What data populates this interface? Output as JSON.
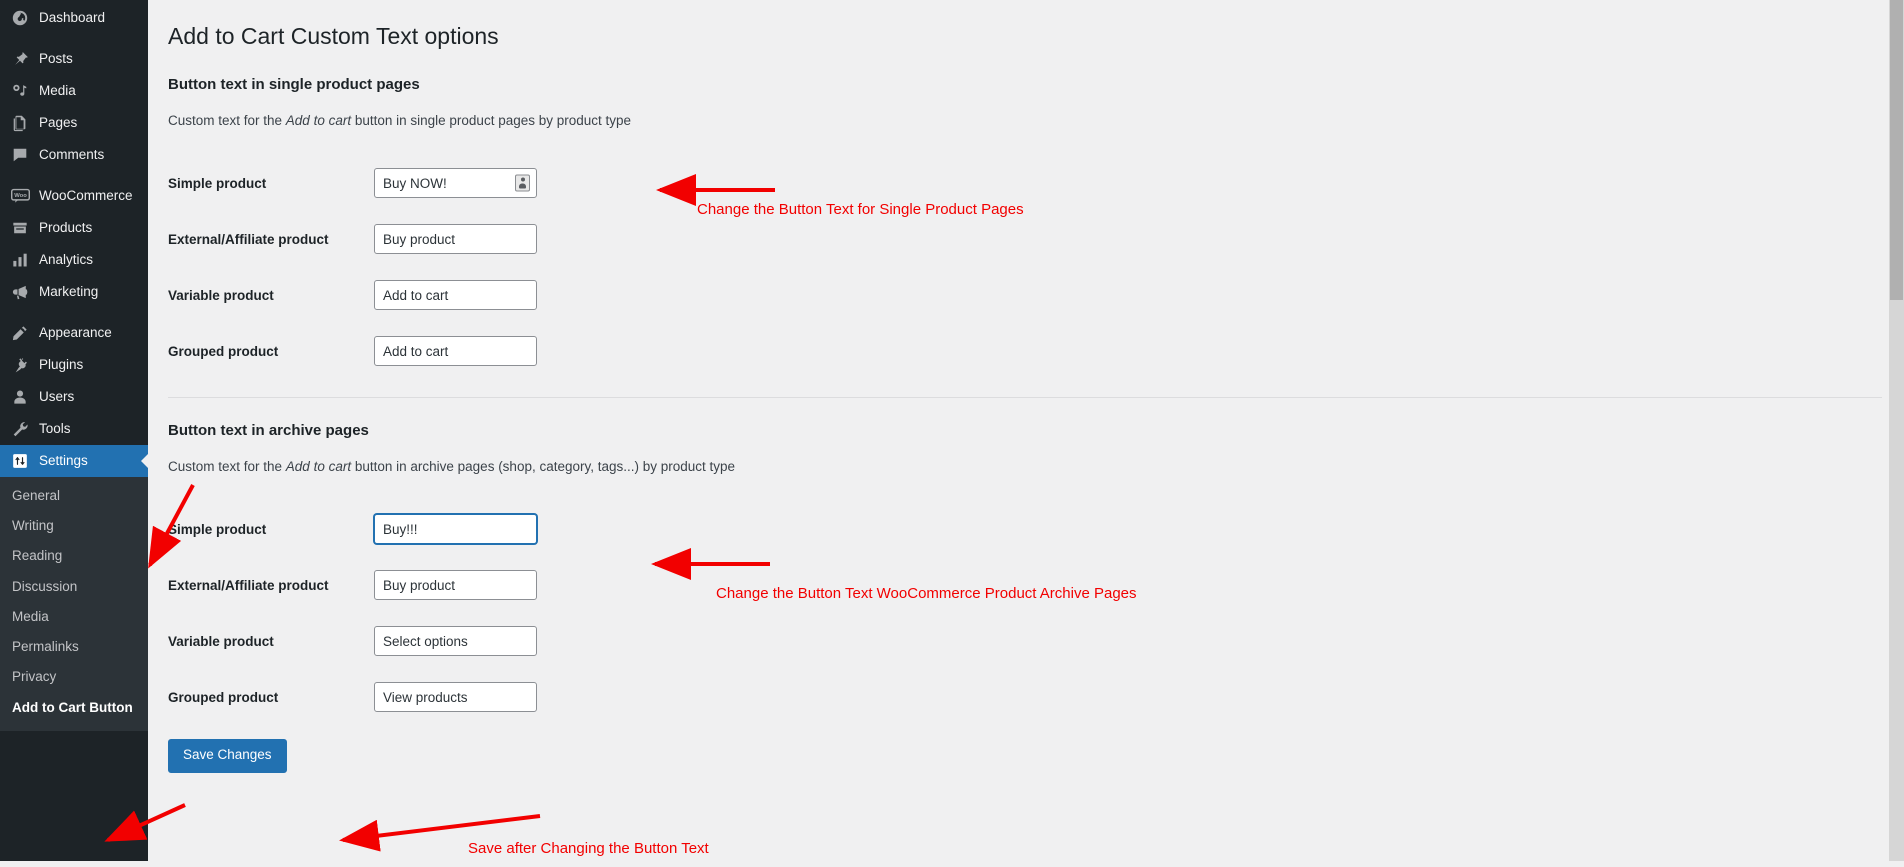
{
  "sidebar": {
    "items": [
      {
        "label": "Dashboard",
        "icon": "dashboard-icon",
        "sep_after": true
      },
      {
        "label": "Posts",
        "icon": "pin-icon",
        "sep_after": false
      },
      {
        "label": "Media",
        "icon": "media-icon",
        "sep_after": false
      },
      {
        "label": "Pages",
        "icon": "pages-icon",
        "sep_after": false
      },
      {
        "label": "Comments",
        "icon": "comments-icon",
        "sep_after": true
      },
      {
        "label": "WooCommerce",
        "icon": "woocommerce-icon",
        "sep_after": false
      },
      {
        "label": "Products",
        "icon": "products-icon",
        "sep_after": false
      },
      {
        "label": "Analytics",
        "icon": "analytics-icon",
        "sep_after": false
      },
      {
        "label": "Marketing",
        "icon": "marketing-icon",
        "sep_after": true
      },
      {
        "label": "Appearance",
        "icon": "appearance-icon",
        "sep_after": false
      },
      {
        "label": "Plugins",
        "icon": "plugins-icon",
        "sep_after": false
      },
      {
        "label": "Users",
        "icon": "users-icon",
        "sep_after": false
      },
      {
        "label": "Tools",
        "icon": "tools-icon",
        "sep_after": false
      },
      {
        "label": "Settings",
        "icon": "settings-icon",
        "sep_after": false,
        "current": true
      }
    ],
    "submenu": [
      {
        "label": "General"
      },
      {
        "label": "Writing"
      },
      {
        "label": "Reading"
      },
      {
        "label": "Discussion"
      },
      {
        "label": "Media"
      },
      {
        "label": "Permalinks"
      },
      {
        "label": "Privacy"
      },
      {
        "label": "Add to Cart Button",
        "current": true
      }
    ]
  },
  "page": {
    "title": "Add to Cart Custom Text options",
    "save_label": "Save Changes"
  },
  "sections": [
    {
      "heading": "Button text in single product pages",
      "desc_before": "Custom text for the ",
      "desc_em": "Add to cart",
      "desc_after": " button in single product pages by product type",
      "rows": [
        {
          "label": "Simple product",
          "value": "Buy NOW!",
          "has_autofill": true,
          "focused": false
        },
        {
          "label": "External/Affiliate product",
          "value": "Buy product",
          "has_autofill": false,
          "focused": false
        },
        {
          "label": "Variable product",
          "value": "Add to cart",
          "has_autofill": false,
          "focused": false
        },
        {
          "label": "Grouped product",
          "value": "Add to cart",
          "has_autofill": false,
          "focused": false
        }
      ]
    },
    {
      "heading": "Button text in archive pages",
      "desc_before": "Custom text for the ",
      "desc_em": "Add to cart",
      "desc_after": " button in archive pages (shop, category, tags...) by product type",
      "rows": [
        {
          "label": "Simple product",
          "value": "Buy!!!",
          "has_autofill": false,
          "focused": true
        },
        {
          "label": "External/Affiliate product",
          "value": "Buy product",
          "has_autofill": false,
          "focused": false
        },
        {
          "label": "Variable product",
          "value": "Select options",
          "has_autofill": false,
          "focused": false
        },
        {
          "label": "Grouped product",
          "value": "View products",
          "has_autofill": false,
          "focused": false
        }
      ]
    }
  ],
  "annotations": {
    "color": "#f20000",
    "single_product": "Change the Button Text for Single Product Pages",
    "archive_product": "Change the Button Text WooCommerce Product Archive Pages",
    "save": "Save after Changing the Button Text"
  }
}
